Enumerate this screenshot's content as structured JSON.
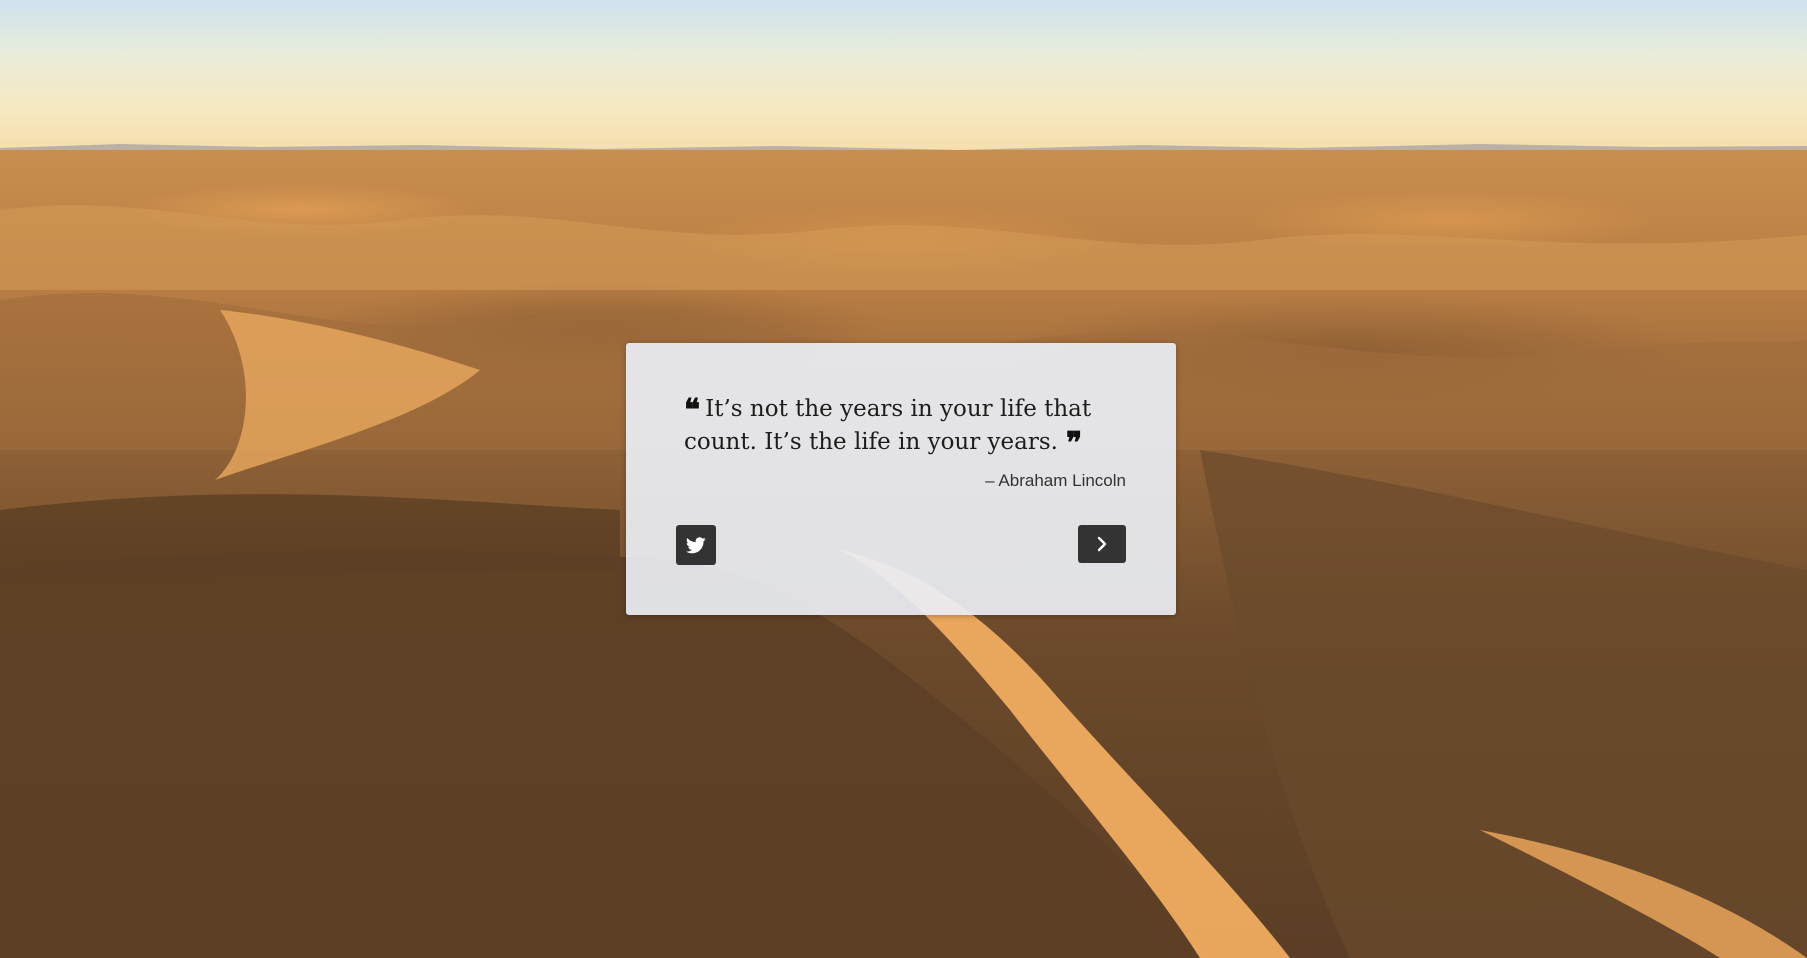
{
  "quote": {
    "text": "It’s not the years in your life that count. It’s the life in your years.",
    "author": "– Abraham Lincoln",
    "open_mark": "❝",
    "close_mark": "❞"
  },
  "actions": {
    "tweet_icon": "twitter-icon",
    "next_icon": "chevron-right-icon"
  },
  "colors": {
    "button": "#333333",
    "card_background": "#e9edf3",
    "quote_text": "#1d1d1d"
  }
}
